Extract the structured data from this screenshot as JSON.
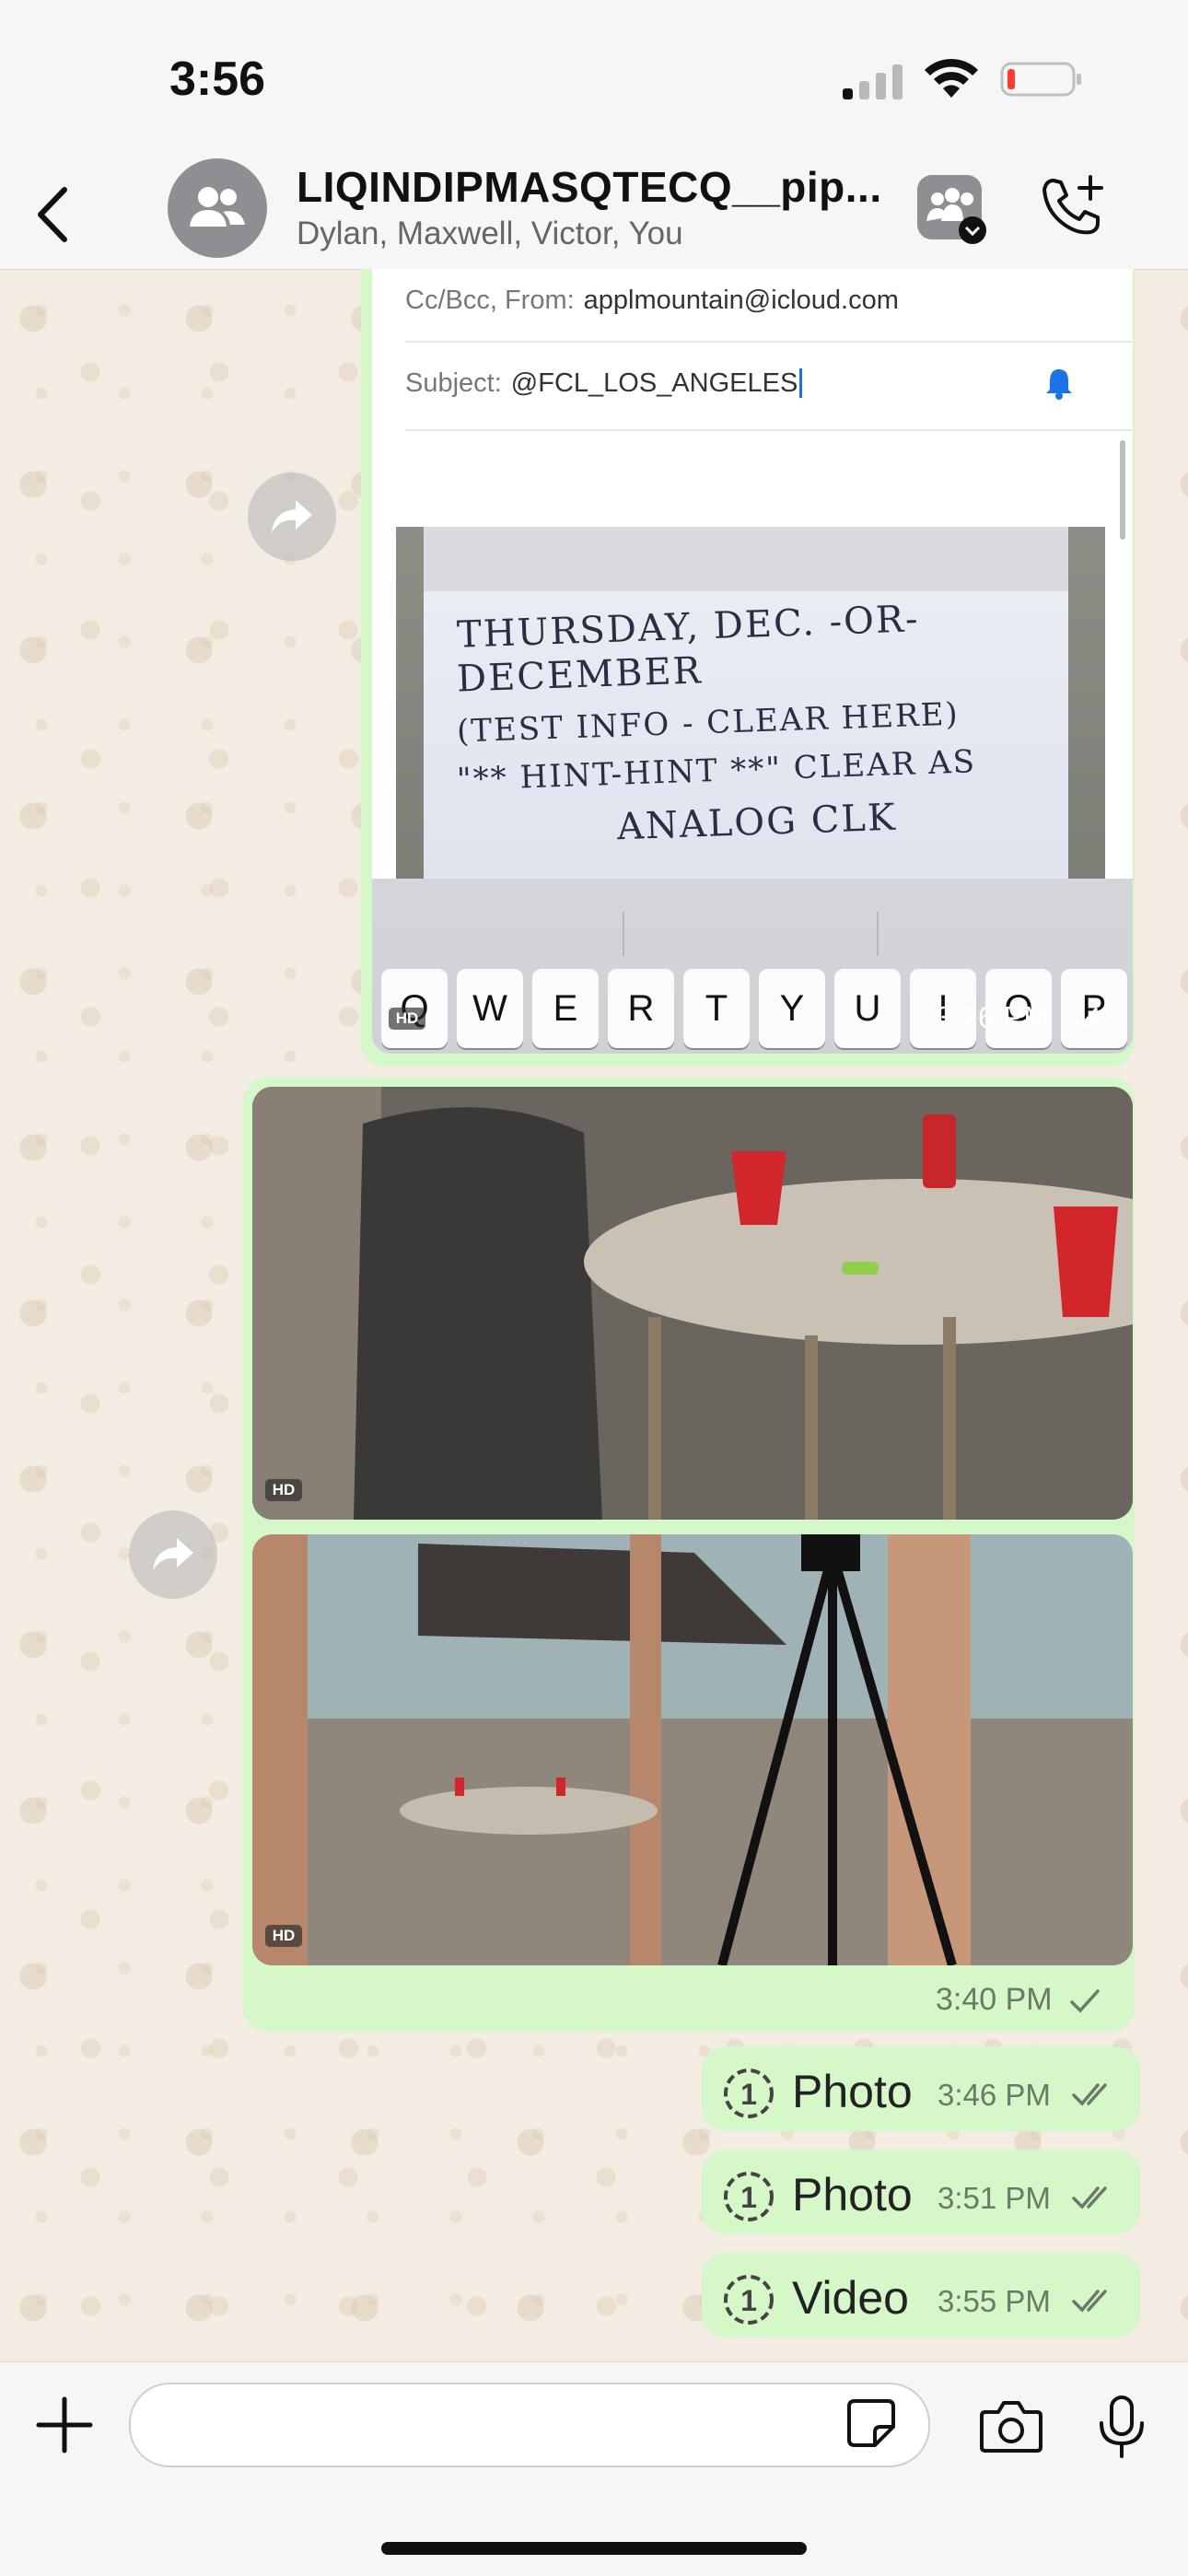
{
  "status_bar": {
    "time": "3:56"
  },
  "header": {
    "title": "LIQINDIPMASQTECQ__pip...",
    "members": "Dylan, Maxwell, Victor, You"
  },
  "messages": {
    "screenshot": {
      "mail_from_label": "Cc/Bcc, From:",
      "mail_from_value": "applmountain@icloud.com",
      "mail_subject_label": "Subject:",
      "mail_subject_value": "@FCL_LOS_ANGELES",
      "note_lines": [
        "THURSDAY, DEC. -OR-",
        "DECEMBER",
        "(TEST INFO - CLEAR HERE)",
        "\"** HINT-HINT **\"  CLEAR AS",
        "ANALOG CLK"
      ],
      "keys": [
        "Q",
        "W",
        "E",
        "R",
        "T",
        "Y",
        "U",
        "I",
        "O",
        "P"
      ],
      "hd": "HD",
      "time": "3:26 PM"
    },
    "photo_group": {
      "hd_1": "HD",
      "hd_2": "HD",
      "time": "3:40 PM"
    },
    "view_once": [
      {
        "label": "Photo",
        "time": "3:46 PM"
      },
      {
        "label": "Photo",
        "time": "3:51 PM"
      },
      {
        "label": "Video",
        "time": "3:55 PM"
      }
    ]
  },
  "icons": {
    "back": "chevron-left-icon",
    "avatar": "group-icon",
    "community": "community-icon",
    "call": "add-call-icon",
    "forward": "forward-icon",
    "view_once": "view-once-icon",
    "plus": "plus-icon",
    "sticker": "sticker-icon",
    "camera": "camera-icon",
    "mic": "microphone-icon"
  },
  "colors": {
    "outgoing_bubble": "#d4f8c8",
    "read_receipt": "#6b7a66",
    "accent_blue": "#1a73e8"
  }
}
